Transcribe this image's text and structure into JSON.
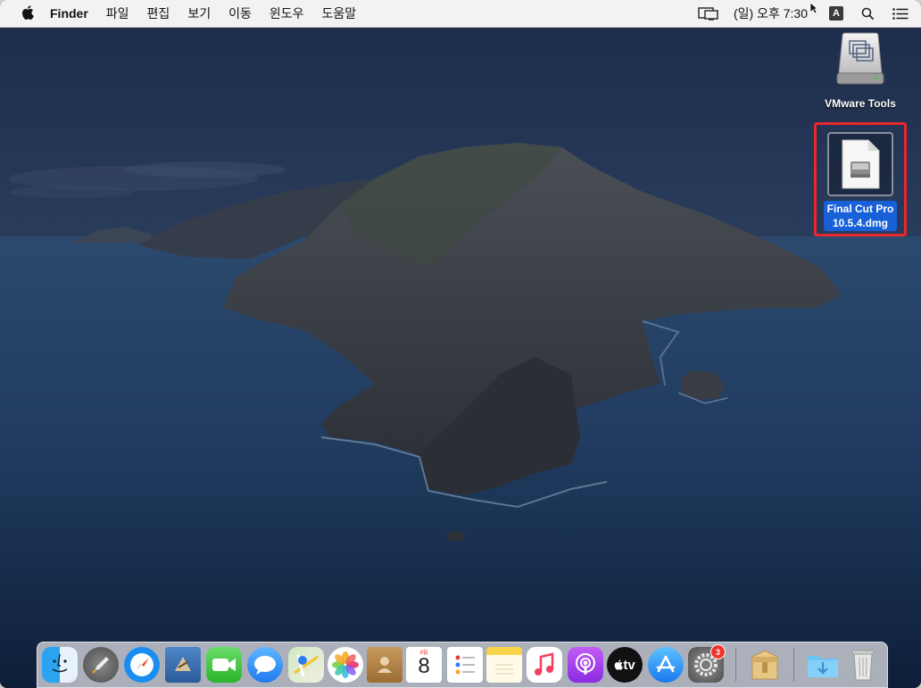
{
  "menubar": {
    "apple_icon": "apple-icon",
    "app_name": "Finder",
    "menus": [
      "파일",
      "편집",
      "보기",
      "이동",
      "윈도우",
      "도움말"
    ],
    "clock": "(일) 오후 7:30",
    "input_source": "A",
    "status_icons": [
      "display-mirroring-icon",
      "input-source-icon",
      "spotlight-icon",
      "notification-center-icon"
    ]
  },
  "desktop": {
    "items": [
      {
        "label": "VMware Tools",
        "icon": "vmware-drive-icon",
        "selected": false
      },
      {
        "label_line1": "Final Cut Pro",
        "label_line2": "10.5.4.dmg",
        "icon": "disk-image-icon",
        "selected": true
      }
    ],
    "highlight_color": "#e8282c",
    "selection_color": "#1760d8"
  },
  "dock": {
    "items": [
      {
        "name": "finder",
        "icon": "finder-icon"
      },
      {
        "name": "launchpad",
        "icon": "launchpad-icon"
      },
      {
        "name": "safari",
        "icon": "safari-icon"
      },
      {
        "name": "mail",
        "icon": "mail-icon"
      },
      {
        "name": "facetime",
        "icon": "facetime-icon"
      },
      {
        "name": "messages",
        "icon": "messages-icon"
      },
      {
        "name": "maps",
        "icon": "maps-icon"
      },
      {
        "name": "photos",
        "icon": "photos-icon"
      },
      {
        "name": "contacts",
        "icon": "contacts-icon"
      },
      {
        "name": "calendar",
        "icon": "calendar-icon",
        "month": "8월",
        "day": "8"
      },
      {
        "name": "reminders",
        "icon": "reminders-icon"
      },
      {
        "name": "notes",
        "icon": "notes-icon"
      },
      {
        "name": "music",
        "icon": "music-icon"
      },
      {
        "name": "podcasts",
        "icon": "podcasts-icon"
      },
      {
        "name": "apple-tv",
        "icon": "apple-tv-icon",
        "label": "tv"
      },
      {
        "name": "app-store",
        "icon": "app-store-icon"
      },
      {
        "name": "system-preferences",
        "icon": "system-preferences-icon",
        "badge": "3"
      },
      {
        "name": "archive-utility",
        "icon": "archive-utility-icon"
      },
      {
        "name": "downloads",
        "icon": "downloads-folder-icon"
      },
      {
        "name": "trash",
        "icon": "trash-icon"
      }
    ]
  }
}
